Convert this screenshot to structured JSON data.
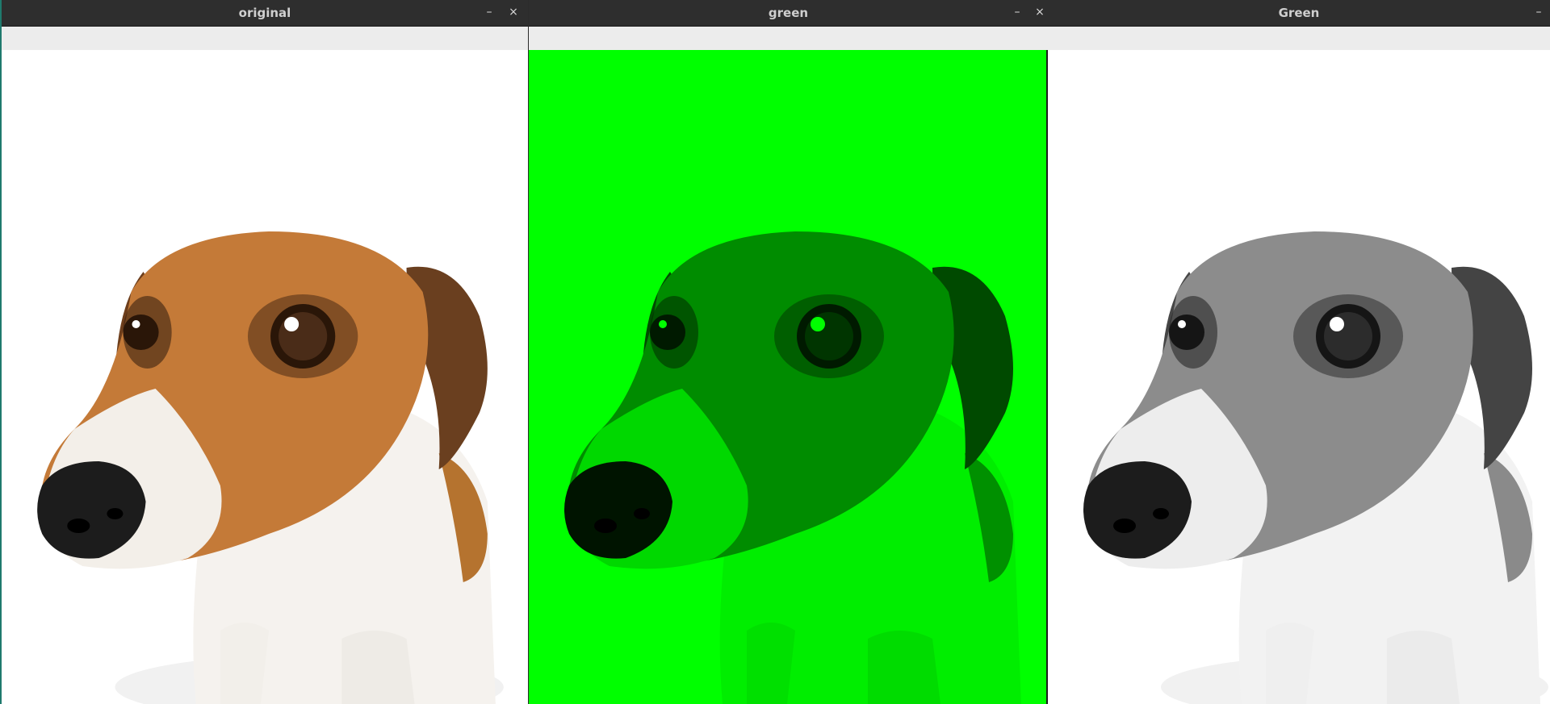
{
  "windows": [
    {
      "title": "original",
      "minimize_glyph": "–",
      "close_glyph": "×",
      "image": {
        "icon": "dog-photo",
        "variant": "color",
        "background": "#ffffff"
      }
    },
    {
      "title": "green",
      "minimize_glyph": "–",
      "close_glyph": "×",
      "image": {
        "icon": "dog-photo",
        "variant": "green-channel",
        "background": "#00ff00"
      }
    },
    {
      "title": "Green",
      "minimize_glyph": "–",
      "image": {
        "icon": "dog-photo",
        "variant": "grayscale",
        "background": "#ffffff"
      }
    }
  ],
  "colors": {
    "titlebar": "#2e2e2e",
    "title_text": "#cfcfcf",
    "toolbar_strip": "#ececec",
    "green_channel": "#00ff00"
  }
}
